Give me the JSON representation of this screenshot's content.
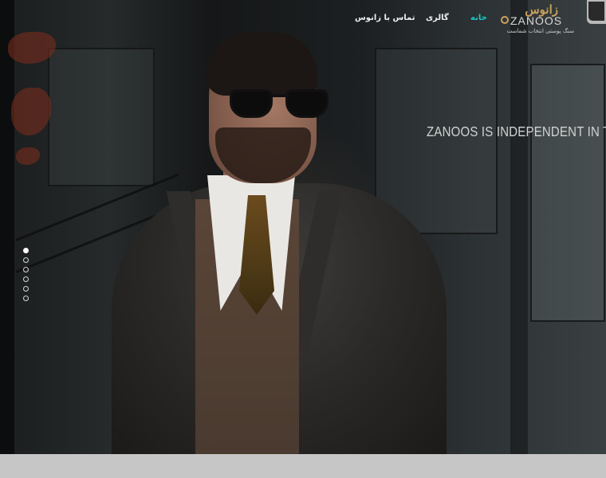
{
  "header": {
    "logo": {
      "fa_name": "زانوس",
      "en_name": "ZANOOS",
      "tagline": "سنگ پوستی انتخاب شماست"
    },
    "nav": [
      {
        "label": "خانه",
        "active": true
      },
      {
        "label": "گالری",
        "active": false
      },
      {
        "label": "تماس با زانوس",
        "active": false
      }
    ]
  },
  "hero": {
    "headline": "ZANOOS IS INDEPENDENT IN THE FIELD OF S",
    "slider": {
      "count": 6,
      "active_index": 0
    }
  },
  "colors": {
    "accent": "#19c4c4",
    "logo_gold": "#c9a15a",
    "footer_strip": "#c6c6c6"
  }
}
